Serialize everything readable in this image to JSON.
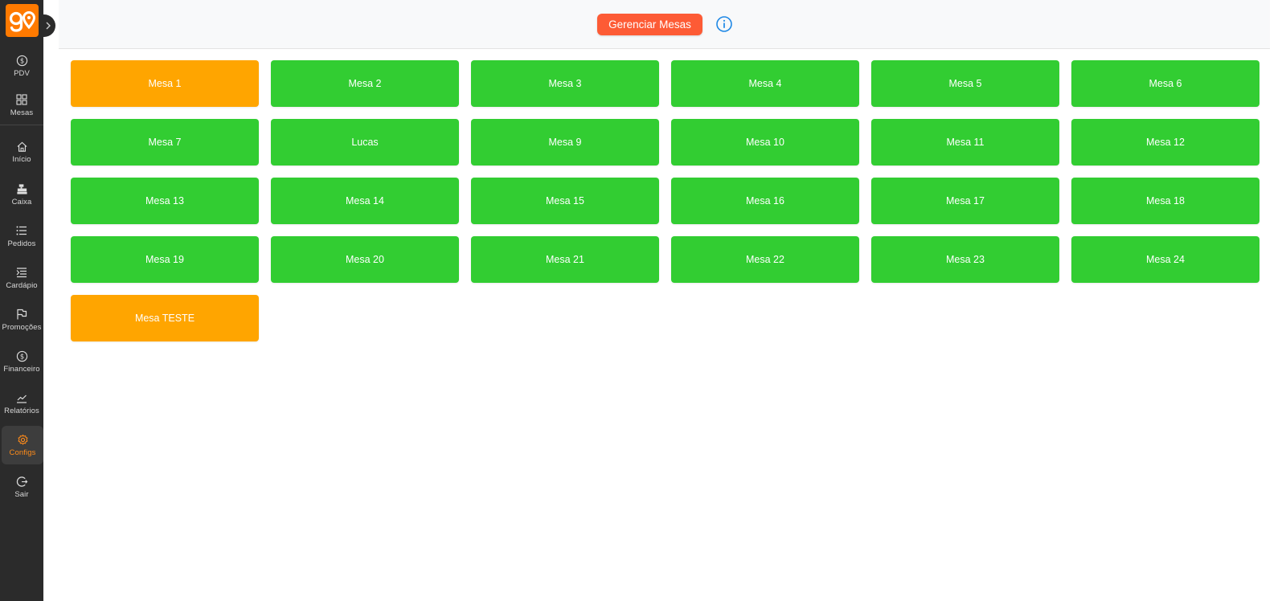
{
  "brand": {
    "logo_text": "go",
    "accent": "#ff7a00"
  },
  "sidebar": {
    "items": [
      {
        "label": "PDV",
        "icon": "dollar-circle-icon"
      },
      {
        "label": "Mesas",
        "icon": "grid-icon"
      },
      {
        "label": "Início",
        "icon": "home-icon"
      },
      {
        "label": "Caixa",
        "icon": "cash-register-icon"
      },
      {
        "label": "Pedidos",
        "icon": "list-icon"
      },
      {
        "label": "Cardápio",
        "icon": "menu-list-icon"
      },
      {
        "label": "Promoções",
        "icon": "flag-icon"
      },
      {
        "label": "Financeiro",
        "icon": "dollar-circle-icon"
      },
      {
        "label": "Relatórios",
        "icon": "chart-line-icon"
      },
      {
        "label": "Configs",
        "icon": "gear-icon",
        "active": true
      },
      {
        "label": "Sair",
        "icon": "logout-icon"
      }
    ]
  },
  "header": {
    "manage_button": "Gerenciar Mesas",
    "info_icon": "info-icon"
  },
  "colors": {
    "free": "#32cd32",
    "occupied": "#ffa500",
    "button": "#fd5b35"
  },
  "tables": [
    {
      "name": "Mesa 1",
      "status": "occupied"
    },
    {
      "name": "Mesa 2",
      "status": "free"
    },
    {
      "name": "Mesa 3",
      "status": "free"
    },
    {
      "name": "Mesa 4",
      "status": "free"
    },
    {
      "name": "Mesa 5",
      "status": "free"
    },
    {
      "name": "Mesa 6",
      "status": "free"
    },
    {
      "name": "Mesa 7",
      "status": "free"
    },
    {
      "name": "Lucas",
      "status": "free"
    },
    {
      "name": "Mesa 9",
      "status": "free"
    },
    {
      "name": "Mesa 10",
      "status": "free"
    },
    {
      "name": "Mesa 11",
      "status": "free"
    },
    {
      "name": "Mesa 12",
      "status": "free"
    },
    {
      "name": "Mesa 13",
      "status": "free"
    },
    {
      "name": "Mesa 14",
      "status": "free"
    },
    {
      "name": "Mesa 15",
      "status": "free"
    },
    {
      "name": "Mesa 16",
      "status": "free"
    },
    {
      "name": "Mesa 17",
      "status": "free"
    },
    {
      "name": "Mesa 18",
      "status": "free"
    },
    {
      "name": "Mesa 19",
      "status": "free"
    },
    {
      "name": "Mesa 20",
      "status": "free"
    },
    {
      "name": "Mesa 21",
      "status": "free"
    },
    {
      "name": "Mesa 22",
      "status": "free"
    },
    {
      "name": "Mesa 23",
      "status": "free"
    },
    {
      "name": "Mesa 24",
      "status": "free"
    },
    {
      "name": "Mesa TESTE",
      "status": "occupied"
    }
  ]
}
